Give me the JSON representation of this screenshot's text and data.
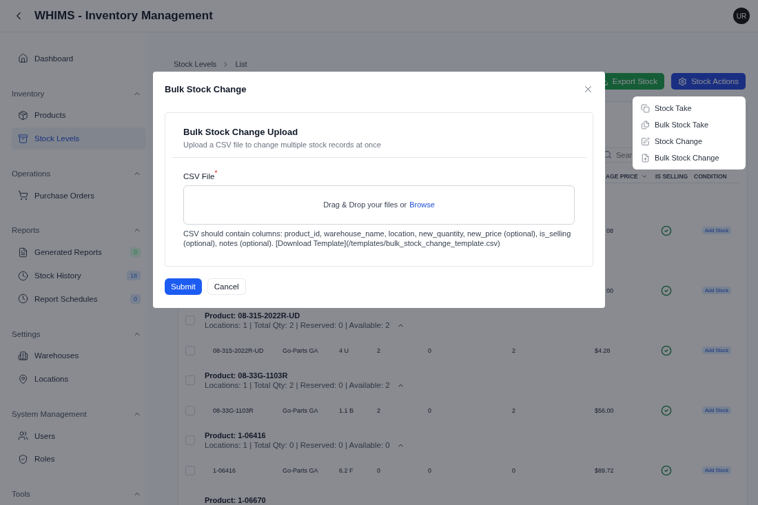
{
  "header": {
    "title": "WHIMS - Inventory Management",
    "avatar": "UR"
  },
  "sidebar": {
    "items": [
      {
        "label": "Dashboard",
        "selected": false
      }
    ],
    "sections": [
      {
        "label": "Inventory",
        "expanded": true,
        "items": [
          {
            "label": "Products",
            "selected": false
          },
          {
            "label": "Stock Levels",
            "selected": true
          }
        ]
      },
      {
        "label": "Operations",
        "expanded": true,
        "items": [
          {
            "label": "Purchase Orders",
            "selected": false
          }
        ]
      },
      {
        "label": "Reports",
        "expanded": true,
        "items": [
          {
            "label": "Generated Reports",
            "selected": false,
            "badge": "0",
            "color": "#788a85"
          },
          {
            "label": "Stock History",
            "selected": false,
            "badge": "18",
            "color": "#788090"
          },
          {
            "label": "Report Schedules",
            "selected": false,
            "badge": "0",
            "color": "#788090"
          }
        ]
      },
      {
        "label": "Settings",
        "expanded": true,
        "items": [
          {
            "label": "Warehouses",
            "selected": false
          },
          {
            "label": "Locations",
            "selected": false
          }
        ]
      },
      {
        "label": "System Management",
        "expanded": true,
        "items": [
          {
            "label": "Users",
            "selected": false
          },
          {
            "label": "Roles",
            "selected": false
          }
        ]
      },
      {
        "label": "Tools",
        "expanded": true
      }
    ]
  },
  "breadcrumb": [
    "Stock Levels",
    "List"
  ],
  "actions": [
    {
      "label": "Export Stock",
      "kind": "export"
    },
    {
      "label": "Stock Actions",
      "kind": "menu"
    }
  ],
  "search": {
    "placeholder": "Sear"
  },
  "table": {
    "columns": [
      {
        "label": "AGE PRICE",
        "sortable": true
      },
      {
        "label": "IS SELLING",
        "sortable": false
      },
      {
        "label": "CONDITION",
        "sortable": false
      }
    ],
    "partial_rows": [
      {
        "price": "08",
        "is_selling": true,
        "condition": "Add Stock"
      },
      {
        "price": "00",
        "is_selling": true,
        "condition": "Add Stock"
      }
    ],
    "groups": [
      {
        "title": "Product: 08-315-2022R-UD",
        "summary": "Locations: 1 | Total Qty: 2 | Reserved: 0 | Available: 2",
        "expanded": true,
        "checked": false,
        "rows": [
          {
            "checked": false,
            "cells": [
              "08-315-2022R-UD",
              "Go-Parts GA",
              "4 U",
              "2",
              "0",
              "2",
              "$4.28"
            ],
            "is_selling": true,
            "condition": "Add Stock"
          }
        ]
      },
      {
        "title": "Product: 08-33G-1103R",
        "summary": "Locations: 1 | Total Qty: 2 | Reserved: 0 | Available: 2",
        "expanded": true,
        "checked": false,
        "rows": [
          {
            "checked": false,
            "cells": [
              "08-33G-1103R",
              "Go-Parts GA",
              "1.1 B",
              "2",
              "0",
              "2",
              "$56.00"
            ],
            "is_selling": true,
            "condition": "Add Stock"
          }
        ]
      },
      {
        "title": "Product: 1-06416",
        "summary": "Locations: 1 | Total Qty: 0 | Reserved: 0 | Available: 0",
        "expanded": true,
        "checked": false,
        "rows": [
          {
            "checked": false,
            "cells": [
              "1-06416",
              "Go-Parts GA",
              "6.2 F",
              "0",
              "0",
              "0",
              "$89.72"
            ],
            "is_selling": true,
            "condition": "Add Stock"
          }
        ]
      },
      {
        "title": "Product: 1-06670"
      }
    ]
  },
  "dropdown": {
    "items": [
      {
        "label": "Stock Take"
      },
      {
        "label": "Bulk Stock Take"
      },
      {
        "label": "Stock Change"
      },
      {
        "label": "Bulk Stock Change"
      }
    ]
  },
  "modal": {
    "title": "Bulk Stock Change",
    "card_title": "Bulk Stock Change Upload",
    "card_subtitle": "Upload a CSV file to change multiple stock records at once",
    "field_label": "CSV File",
    "required_mark": "*",
    "dropzone_text": "Drag & Drop your files or",
    "browse": "Browse",
    "help": "CSV should contain columns: product_id, warehouse_name, location, new_quantity, new_price (optional), is_selling (optional), notes (optional). [Download Template](/templates/bulk_stock_change_template.csv)",
    "buttons": [
      {
        "label": "Submit",
        "kind": "primary"
      },
      {
        "label": "Cancel",
        "kind": "secondary"
      }
    ]
  }
}
